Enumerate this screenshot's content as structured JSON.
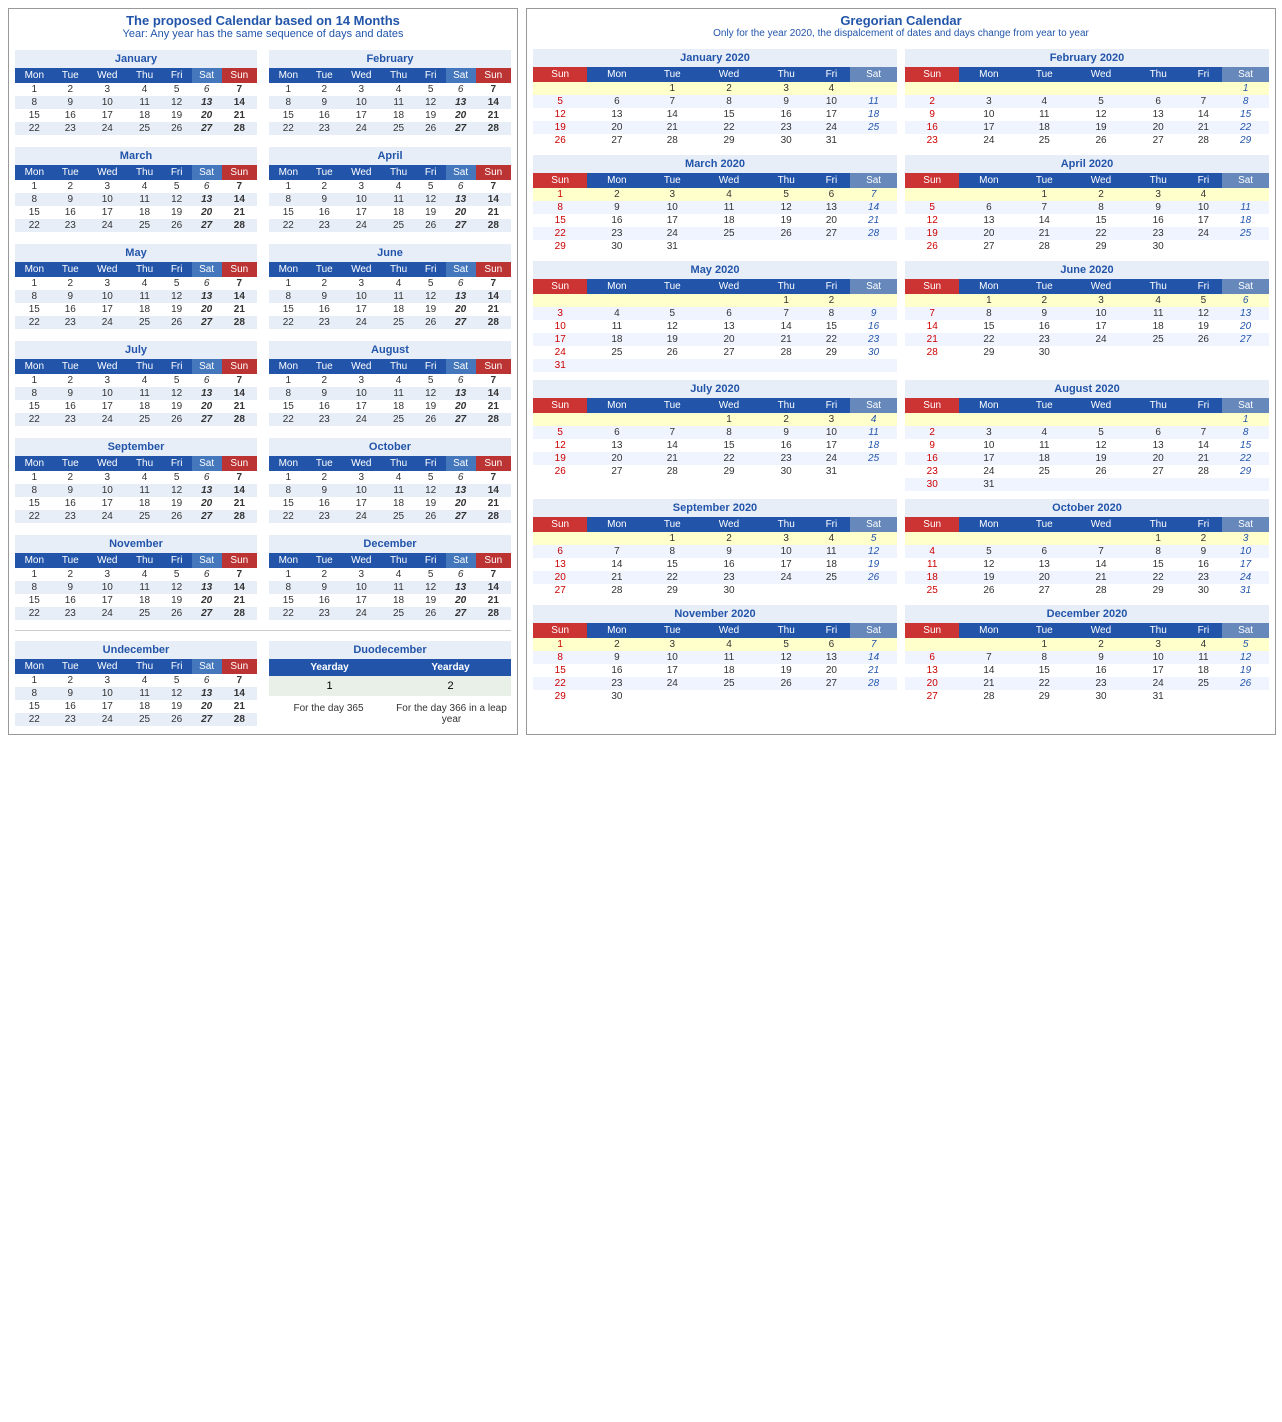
{
  "left": {
    "title": "The proposed Calendar based on 14 Months",
    "subtitle": "Year: Any year has the same sequence of days and dates",
    "months": [
      {
        "name": "January",
        "weeks": [
          [
            1,
            2,
            3,
            4,
            "5",
            "6",
            "7"
          ],
          [
            8,
            9,
            10,
            11,
            12,
            "13",
            "14"
          ],
          [
            15,
            16,
            17,
            18,
            19,
            "20",
            "21"
          ],
          [
            22,
            23,
            24,
            25,
            26,
            "27",
            "28"
          ]
        ]
      },
      {
        "name": "February",
        "weeks": [
          [
            1,
            2,
            3,
            4,
            "5",
            "6",
            "7"
          ],
          [
            8,
            9,
            10,
            11,
            12,
            "13",
            "14"
          ],
          [
            15,
            16,
            17,
            18,
            19,
            "20",
            "21"
          ],
          [
            22,
            23,
            24,
            25,
            26,
            "27",
            "28"
          ]
        ]
      },
      {
        "name": "March",
        "weeks": [
          [
            1,
            2,
            3,
            4,
            "5",
            "6",
            "7"
          ],
          [
            8,
            9,
            10,
            11,
            12,
            "13",
            "14"
          ],
          [
            15,
            16,
            17,
            18,
            19,
            "20",
            "21"
          ],
          [
            22,
            23,
            24,
            25,
            26,
            "27",
            "28"
          ]
        ]
      },
      {
        "name": "April",
        "weeks": [
          [
            1,
            2,
            3,
            4,
            "5",
            "6",
            "7"
          ],
          [
            8,
            9,
            10,
            11,
            12,
            "13",
            "14"
          ],
          [
            15,
            16,
            17,
            18,
            19,
            "20",
            "21"
          ],
          [
            22,
            23,
            24,
            25,
            26,
            "27",
            "28"
          ]
        ]
      },
      {
        "name": "May",
        "weeks": [
          [
            1,
            2,
            3,
            4,
            "5",
            "6",
            "7"
          ],
          [
            8,
            9,
            10,
            11,
            12,
            "13",
            "14"
          ],
          [
            15,
            16,
            17,
            18,
            19,
            "20",
            "21"
          ],
          [
            22,
            23,
            24,
            25,
            26,
            "27",
            "28"
          ]
        ]
      },
      {
        "name": "June",
        "weeks": [
          [
            1,
            2,
            3,
            4,
            "5",
            "6",
            "7"
          ],
          [
            8,
            9,
            10,
            11,
            12,
            "13",
            "14"
          ],
          [
            15,
            16,
            17,
            18,
            19,
            "20",
            "21"
          ],
          [
            22,
            23,
            24,
            25,
            26,
            "27",
            "28"
          ]
        ]
      },
      {
        "name": "July",
        "weeks": [
          [
            1,
            2,
            3,
            4,
            "5",
            "6",
            "7"
          ],
          [
            8,
            9,
            10,
            11,
            12,
            "13",
            "14"
          ],
          [
            15,
            16,
            17,
            18,
            19,
            "20",
            "21"
          ],
          [
            22,
            23,
            24,
            25,
            26,
            "27",
            "28"
          ]
        ]
      },
      {
        "name": "August",
        "weeks": [
          [
            1,
            2,
            3,
            4,
            "5",
            "6",
            "7"
          ],
          [
            8,
            9,
            10,
            11,
            12,
            "13",
            "14"
          ],
          [
            15,
            16,
            17,
            18,
            19,
            "20",
            "21"
          ],
          [
            22,
            23,
            24,
            25,
            26,
            "27",
            "28"
          ]
        ]
      },
      {
        "name": "September",
        "weeks": [
          [
            1,
            2,
            3,
            4,
            "5",
            "6",
            "7"
          ],
          [
            8,
            9,
            10,
            11,
            12,
            "13",
            "14"
          ],
          [
            15,
            16,
            17,
            18,
            19,
            "20",
            "21"
          ],
          [
            22,
            23,
            24,
            25,
            26,
            "27",
            "28"
          ]
        ]
      },
      {
        "name": "October",
        "weeks": [
          [
            1,
            2,
            3,
            4,
            "5",
            "6",
            "7"
          ],
          [
            8,
            9,
            10,
            11,
            12,
            "13",
            "14"
          ],
          [
            15,
            16,
            17,
            18,
            19,
            "20",
            "21"
          ],
          [
            22,
            23,
            24,
            25,
            26,
            "27",
            "28"
          ]
        ]
      },
      {
        "name": "November",
        "weeks": [
          [
            1,
            2,
            3,
            4,
            "5",
            "6",
            "7"
          ],
          [
            8,
            9,
            10,
            11,
            12,
            "13",
            "14"
          ],
          [
            15,
            16,
            17,
            18,
            19,
            "20",
            "21"
          ],
          [
            22,
            23,
            24,
            25,
            26,
            "27",
            "28"
          ]
        ]
      },
      {
        "name": "December",
        "weeks": [
          [
            1,
            2,
            3,
            4,
            "5",
            "6",
            "7"
          ],
          [
            8,
            9,
            10,
            11,
            12,
            "13",
            "14"
          ],
          [
            15,
            16,
            17,
            18,
            19,
            "20",
            "21"
          ],
          [
            22,
            23,
            24,
            25,
            26,
            "27",
            "28"
          ]
        ]
      },
      {
        "name": "Undecember",
        "weeks": [
          [
            1,
            2,
            3,
            4,
            "5",
            "6",
            "7"
          ],
          [
            8,
            9,
            10,
            11,
            12,
            "13",
            "14"
          ],
          [
            15,
            16,
            17,
            18,
            19,
            "20",
            "21"
          ],
          [
            22,
            23,
            24,
            25,
            26,
            "27",
            "28"
          ]
        ]
      }
    ],
    "duodecember": {
      "name": "Duodecember",
      "col1": "Yearday",
      "col2": "Yearday",
      "val1": "1",
      "val2": "2",
      "note1": "For the day 365",
      "note2": "For the day 366 in a leap year"
    }
  },
  "right": {
    "title": "Gregorian Calendar",
    "subtitle": "Only for the year 2020, the dispalcement of dates and days change from year to year",
    "months": [
      {
        "name": "January 2020",
        "startDay": 3,
        "days": 31,
        "rows": [
          [
            "",
            "",
            "1",
            "2",
            "3",
            "4",
            ""
          ],
          [
            "5",
            "6",
            "7",
            "8",
            "9",
            "10",
            "11"
          ],
          [
            "12",
            "13",
            "14",
            "15",
            "16",
            "17",
            "18"
          ],
          [
            "19",
            "20",
            "21",
            "22",
            "23",
            "24",
            "25"
          ],
          [
            "26",
            "27",
            "28",
            "29",
            "30",
            "31",
            ""
          ]
        ]
      },
      {
        "name": "February 2020",
        "rows": [
          [
            "",
            "",
            "",
            "",
            "",
            "",
            "1"
          ],
          [
            "2",
            "3",
            "4",
            "5",
            "6",
            "7",
            "8"
          ],
          [
            "9",
            "10",
            "11",
            "12",
            "13",
            "14",
            "15"
          ],
          [
            "16",
            "17",
            "18",
            "19",
            "20",
            "21",
            "22"
          ],
          [
            "23",
            "24",
            "25",
            "26",
            "27",
            "28",
            "29"
          ]
        ]
      },
      {
        "name": "March 2020",
        "rows": [
          [
            "1",
            "2",
            "3",
            "4",
            "5",
            "6",
            "7"
          ],
          [
            "8",
            "9",
            "10",
            "11",
            "12",
            "13",
            "14"
          ],
          [
            "15",
            "16",
            "17",
            "18",
            "19",
            "20",
            "21"
          ],
          [
            "22",
            "23",
            "24",
            "25",
            "26",
            "27",
            "28"
          ],
          [
            "29",
            "30",
            "31",
            "",
            "",
            "",
            ""
          ]
        ]
      },
      {
        "name": "April 2020",
        "rows": [
          [
            "",
            "",
            "1",
            "2",
            "3",
            "4",
            ""
          ],
          [
            "5",
            "6",
            "7",
            "8",
            "9",
            "10",
            "11"
          ],
          [
            "12",
            "13",
            "14",
            "15",
            "16",
            "17",
            "18"
          ],
          [
            "19",
            "20",
            "21",
            "22",
            "23",
            "24",
            "25"
          ],
          [
            "26",
            "27",
            "28",
            "29",
            "30",
            "",
            ""
          ]
        ]
      },
      {
        "name": "May 2020",
        "rows": [
          [
            "",
            "",
            "",
            "",
            "1",
            "2",
            ""
          ],
          [
            "3",
            "4",
            "5",
            "6",
            "7",
            "8",
            "9"
          ],
          [
            "10",
            "11",
            "12",
            "13",
            "14",
            "15",
            "16"
          ],
          [
            "17",
            "18",
            "19",
            "20",
            "21",
            "22",
            "23"
          ],
          [
            "24",
            "25",
            "26",
            "27",
            "28",
            "29",
            "30"
          ],
          [
            "31",
            "",
            "",
            "",
            "",
            "",
            ""
          ]
        ]
      },
      {
        "name": "June 2020",
        "rows": [
          [
            "",
            "1",
            "2",
            "3",
            "4",
            "5",
            "6"
          ],
          [
            "7",
            "8",
            "9",
            "10",
            "11",
            "12",
            "13"
          ],
          [
            "14",
            "15",
            "16",
            "17",
            "18",
            "19",
            "20"
          ],
          [
            "21",
            "22",
            "23",
            "24",
            "25",
            "26",
            "27"
          ],
          [
            "28",
            "29",
            "30",
            "",
            "",
            "",
            ""
          ]
        ]
      },
      {
        "name": "July 2020",
        "rows": [
          [
            "",
            "",
            "",
            "1",
            "2",
            "3",
            "4"
          ],
          [
            "5",
            "6",
            "7",
            "8",
            "9",
            "10",
            "11"
          ],
          [
            "12",
            "13",
            "14",
            "15",
            "16",
            "17",
            "18"
          ],
          [
            "19",
            "20",
            "21",
            "22",
            "23",
            "24",
            "25"
          ],
          [
            "26",
            "27",
            "28",
            "29",
            "30",
            "31",
            ""
          ]
        ]
      },
      {
        "name": "August 2020",
        "rows": [
          [
            "",
            "",
            "",
            "",
            "",
            "",
            "1"
          ],
          [
            "2",
            "3",
            "4",
            "5",
            "6",
            "7",
            "8"
          ],
          [
            "9",
            "10",
            "11",
            "12",
            "13",
            "14",
            "15"
          ],
          [
            "16",
            "17",
            "18",
            "19",
            "20",
            "21",
            "22"
          ],
          [
            "23",
            "24",
            "25",
            "26",
            "27",
            "28",
            "29"
          ],
          [
            "30",
            "31",
            "",
            "",
            "",
            "",
            ""
          ]
        ]
      },
      {
        "name": "September 2020",
        "rows": [
          [
            "",
            "",
            "1",
            "2",
            "3",
            "4",
            "5"
          ],
          [
            "6",
            "7",
            "8",
            "9",
            "10",
            "11",
            "12"
          ],
          [
            "13",
            "14",
            "15",
            "16",
            "17",
            "18",
            "19"
          ],
          [
            "20",
            "21",
            "22",
            "23",
            "24",
            "25",
            "26"
          ],
          [
            "27",
            "28",
            "29",
            "30",
            "",
            "",
            ""
          ]
        ]
      },
      {
        "name": "October 2020",
        "rows": [
          [
            "",
            "",
            "",
            "",
            "1",
            "2",
            "3"
          ],
          [
            "4",
            "5",
            "6",
            "7",
            "8",
            "9",
            "10"
          ],
          [
            "11",
            "12",
            "13",
            "14",
            "15",
            "16",
            "17"
          ],
          [
            "18",
            "19",
            "20",
            "21",
            "22",
            "23",
            "24"
          ],
          [
            "25",
            "26",
            "27",
            "28",
            "29",
            "30",
            "31"
          ]
        ]
      },
      {
        "name": "November 2020",
        "rows": [
          [
            "1",
            "2",
            "3",
            "4",
            "5",
            "6",
            "7"
          ],
          [
            "8",
            "9",
            "10",
            "11",
            "12",
            "13",
            "14"
          ],
          [
            "15",
            "16",
            "17",
            "18",
            "19",
            "20",
            "21"
          ],
          [
            "22",
            "23",
            "24",
            "25",
            "26",
            "27",
            "28"
          ],
          [
            "29",
            "30",
            "",
            "",
            "",
            "",
            ""
          ]
        ]
      },
      {
        "name": "December 2020",
        "rows": [
          [
            "",
            "",
            "1",
            "2",
            "3",
            "4",
            "5"
          ],
          [
            "6",
            "7",
            "8",
            "9",
            "10",
            "11",
            "12"
          ],
          [
            "13",
            "14",
            "15",
            "16",
            "17",
            "18",
            "19"
          ],
          [
            "20",
            "21",
            "22",
            "23",
            "24",
            "25",
            "26"
          ],
          [
            "27",
            "28",
            "29",
            "30",
            "31",
            "",
            ""
          ]
        ]
      }
    ]
  }
}
